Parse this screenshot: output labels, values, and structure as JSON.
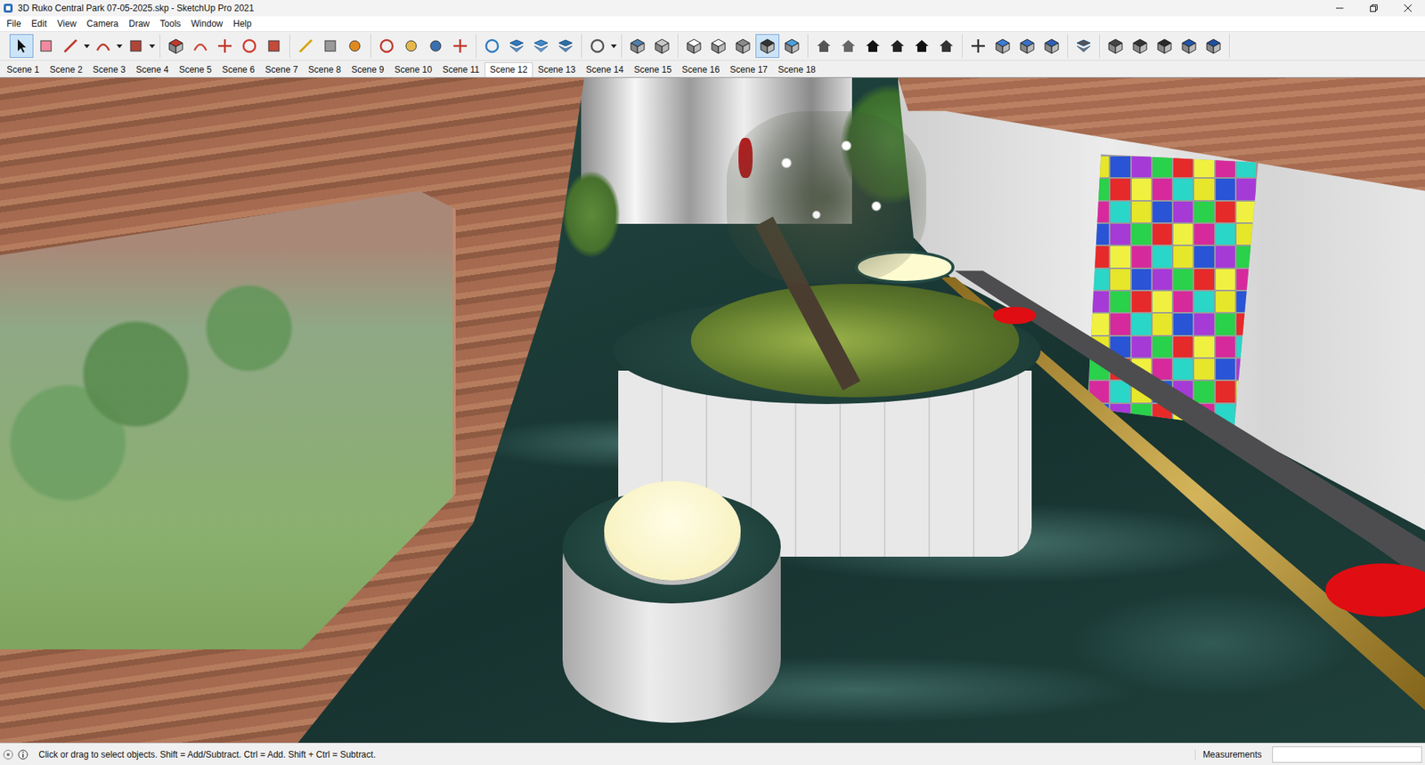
{
  "window": {
    "title": "3D Ruko Central Park 07-05-2025.skp - SketchUp Pro 2021"
  },
  "menu": [
    "File",
    "Edit",
    "View",
    "Camera",
    "Draw",
    "Tools",
    "Window",
    "Help"
  ],
  "toolbar": {
    "groups": [
      [
        {
          "kind": "select",
          "selected": true,
          "dropdown": false
        },
        {
          "kind": "eraser",
          "selected": false,
          "dropdown": false
        },
        {
          "kind": "pencil",
          "selected": false,
          "dropdown": true
        },
        {
          "kind": "arc",
          "selected": false,
          "dropdown": true
        },
        {
          "kind": "shape",
          "selected": false,
          "dropdown": true
        }
      ],
      [
        {
          "kind": "pushpull",
          "selected": false,
          "dropdown": false
        },
        {
          "kind": "followme",
          "selected": false,
          "dropdown": false
        },
        {
          "kind": "move",
          "selected": false,
          "dropdown": false
        },
        {
          "kind": "rotate",
          "selected": false,
          "dropdown": false
        },
        {
          "kind": "scale",
          "selected": false,
          "dropdown": false
        }
      ],
      [
        {
          "kind": "tape",
          "selected": false,
          "dropdown": false
        },
        {
          "kind": "text",
          "selected": false,
          "dropdown": false
        },
        {
          "kind": "paint",
          "selected": false,
          "dropdown": false
        }
      ],
      [
        {
          "kind": "orbit",
          "selected": false,
          "dropdown": false
        },
        {
          "kind": "pan",
          "selected": false,
          "dropdown": false
        },
        {
          "kind": "zoom",
          "selected": false,
          "dropdown": false
        },
        {
          "kind": "zoomextents",
          "selected": false,
          "dropdown": false
        }
      ],
      [
        {
          "kind": "modelinfo",
          "selected": false,
          "dropdown": false
        },
        {
          "kind": "tags",
          "selected": false,
          "dropdown": false
        },
        {
          "kind": "outliner",
          "selected": false,
          "dropdown": false
        },
        {
          "kind": "styles",
          "selected": false,
          "dropdown": false
        }
      ],
      [
        {
          "kind": "profile",
          "selected": false,
          "dropdown": true
        }
      ],
      [
        {
          "kind": "xray",
          "selected": false,
          "dropdown": false
        },
        {
          "kind": "backedges",
          "selected": false,
          "dropdown": false
        }
      ],
      [
        {
          "kind": "wireframe",
          "selected": false,
          "dropdown": false
        },
        {
          "kind": "hiddenline",
          "selected": false,
          "dropdown": false
        },
        {
          "kind": "shaded",
          "selected": false,
          "dropdown": false
        },
        {
          "kind": "textured",
          "selected": true,
          "dropdown": false
        },
        {
          "kind": "monochrome",
          "selected": false,
          "dropdown": false
        }
      ],
      [
        {
          "kind": "iso",
          "selected": false,
          "dropdown": false
        },
        {
          "kind": "top",
          "selected": false,
          "dropdown": false
        },
        {
          "kind": "front",
          "selected": false,
          "dropdown": false
        },
        {
          "kind": "right",
          "selected": false,
          "dropdown": false
        },
        {
          "kind": "back",
          "selected": false,
          "dropdown": false
        },
        {
          "kind": "left",
          "selected": false,
          "dropdown": false
        }
      ],
      [
        {
          "kind": "sectionplane",
          "selected": false,
          "dropdown": false
        },
        {
          "kind": "sectionshow",
          "selected": false,
          "dropdown": false
        },
        {
          "kind": "sectioncuts",
          "selected": false,
          "dropdown": false
        },
        {
          "kind": "sectionfill",
          "selected": false,
          "dropdown": false
        }
      ],
      [
        {
          "kind": "component",
          "selected": false,
          "dropdown": false
        }
      ],
      [
        {
          "kind": "outershell",
          "selected": false,
          "dropdown": false
        },
        {
          "kind": "intersect",
          "selected": false,
          "dropdown": false
        },
        {
          "kind": "union",
          "selected": false,
          "dropdown": false
        },
        {
          "kind": "subtract",
          "selected": false,
          "dropdown": false
        },
        {
          "kind": "trim",
          "selected": false,
          "dropdown": false
        }
      ]
    ]
  },
  "scenes": [
    {
      "label": "Scene 1",
      "selected": false
    },
    {
      "label": "Scene 2",
      "selected": false
    },
    {
      "label": "Scene 3",
      "selected": false
    },
    {
      "label": "Scene 4",
      "selected": false
    },
    {
      "label": "Scene 5",
      "selected": false
    },
    {
      "label": "Scene 6",
      "selected": false
    },
    {
      "label": "Scene 7",
      "selected": false
    },
    {
      "label": "Scene 8",
      "selected": false
    },
    {
      "label": "Scene 9",
      "selected": false
    },
    {
      "label": "Scene 10",
      "selected": false
    },
    {
      "label": "Scene 11",
      "selected": false
    },
    {
      "label": "Scene 12",
      "selected": true
    },
    {
      "label": "Scene 13",
      "selected": false
    },
    {
      "label": "Scene 14",
      "selected": false
    },
    {
      "label": "Scene 15",
      "selected": false
    },
    {
      "label": "Scene 16",
      "selected": false
    },
    {
      "label": "Scene 17",
      "selected": false
    },
    {
      "label": "Scene 18",
      "selected": false
    }
  ],
  "status_bar": {
    "hint": "Click or drag to select objects. Shift = Add/Subtract. Ctrl = Add. Shift + Ctrl = Subtract.",
    "measurements_label": "Measurements",
    "measurements_value": ""
  }
}
